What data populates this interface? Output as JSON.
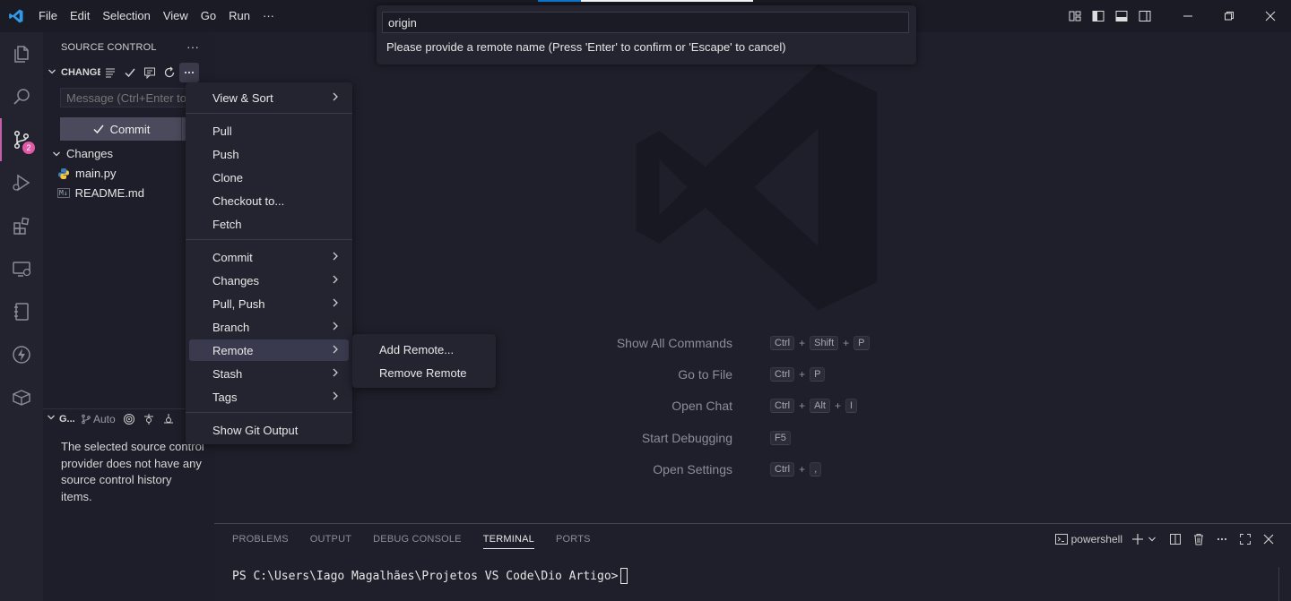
{
  "titlebar": {
    "menu": [
      "File",
      "Edit",
      "Selection",
      "View",
      "Go",
      "Run",
      "···"
    ]
  },
  "colors": {
    "accent": "#0e7ad2",
    "badge": "#e05aa8"
  },
  "activitybar": {
    "items": [
      "explorer-icon",
      "search-icon",
      "source-control-icon",
      "run-debug-icon",
      "extensions-icon",
      "remote-explorer-icon",
      "notebook-icon",
      "lightning-icon",
      "package-icon"
    ],
    "source_control_badge": "2"
  },
  "sidebar": {
    "title": "SOURCE CONTROL",
    "more": "···",
    "changes_section": "CHANGES",
    "message_placeholder": "Message (Ctrl+Enter to commit on 'main')",
    "commit_label": "Commit",
    "changes_group": "Changes",
    "files": [
      "main.py",
      "README.md"
    ],
    "readme_badge": "M↓",
    "graph_section": "GRAPH",
    "graph_auto": "Auto",
    "graph_message": "The selected source control provider does not have any source control history items."
  },
  "quickinput": {
    "value": "origin",
    "message": "Please provide a remote name (Press 'Enter' to confirm or 'Escape' to cancel)"
  },
  "context_menu": {
    "group1": [
      "View & Sort"
    ],
    "group2": [
      "Pull",
      "Push",
      "Clone",
      "Checkout to...",
      "Fetch"
    ],
    "group3": [
      "Commit",
      "Changes",
      "Pull, Push",
      "Branch",
      "Remote",
      "Stash",
      "Tags"
    ],
    "group4": [
      "Show Git Output"
    ],
    "active": "Remote"
  },
  "submenu": {
    "items": [
      "Add Remote...",
      "Remove Remote"
    ]
  },
  "shortcuts": [
    {
      "label": "Show All Commands",
      "keys": [
        "Ctrl",
        "Shift",
        "P"
      ]
    },
    {
      "label": "Go to File",
      "keys": [
        "Ctrl",
        "P"
      ]
    },
    {
      "label": "Open Chat",
      "keys": [
        "Ctrl",
        "Alt",
        "I"
      ]
    },
    {
      "label": "Start Debugging",
      "keys": [
        "F5"
      ]
    },
    {
      "label": "Open Settings",
      "keys": [
        "Ctrl",
        ","
      ]
    }
  ],
  "panel": {
    "tabs": [
      "PROBLEMS",
      "OUTPUT",
      "DEBUG CONSOLE",
      "TERMINAL",
      "PORTS"
    ],
    "active_tab": "TERMINAL",
    "terminal_name": "powershell",
    "prompt": "PS C:\\Users\\Iago Magalhães\\Projetos VS Code\\Dio Artigo>"
  }
}
